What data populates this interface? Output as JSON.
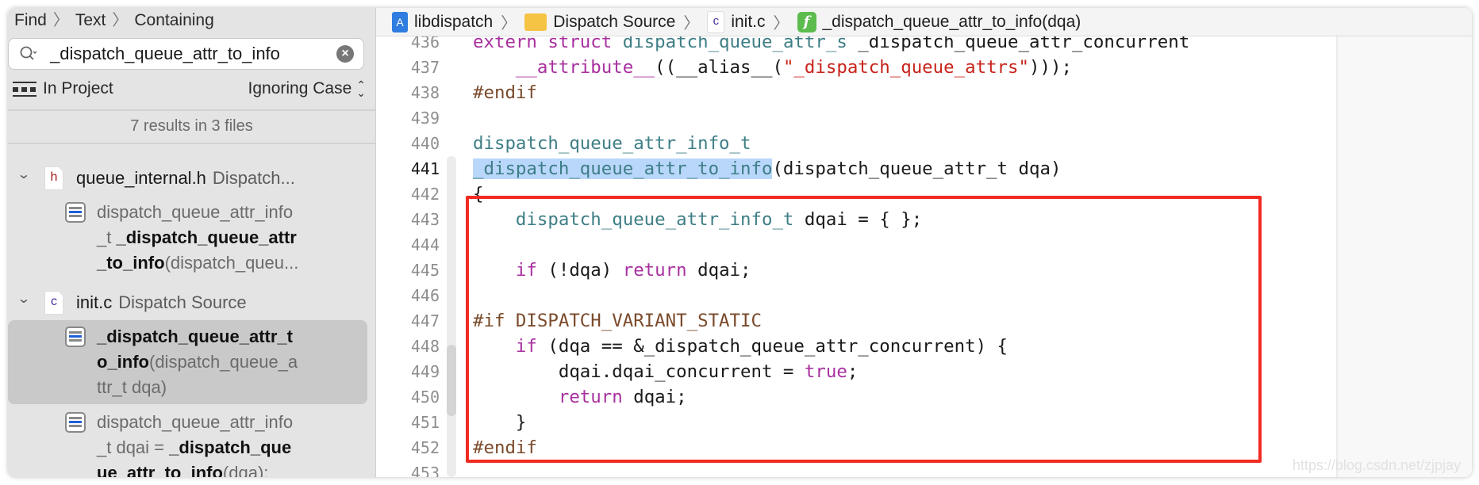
{
  "colors": {
    "type": "#3e7e86",
    "keyword": "#a8309f",
    "preproc": "#7a4a2a",
    "string": "#c8241c",
    "plain": "#1a1a1a",
    "highlight": "#b8d7fb",
    "annotation_box": "#f22a22"
  },
  "sidebar": {
    "find_path": [
      "Find",
      "Text",
      "Containing"
    ],
    "search": {
      "value": "_dispatch_queue_attr_to_info",
      "icon": "magnifier-with-dropdown",
      "clear_icon": "x-circle"
    },
    "scope": "In Project",
    "case_mode": "Ignoring Case",
    "results_summary": "7 results in 3 files",
    "files": [
      {
        "icon": "h",
        "name": "queue_internal.h",
        "group": "Dispatch...",
        "results": [
          {
            "selected": false,
            "lines": [
              [
                {
                  "t": "dispatch_queue_attr_info",
                  "b": false
                }
              ],
              [
                {
                  "t": "_t ",
                  "b": false
                },
                {
                  "t": "_dispatch_queue_attr",
                  "b": true
                }
              ],
              [
                {
                  "t": "_to_info",
                  "b": true
                },
                {
                  "t": "(dispatch_queu...",
                  "b": false
                }
              ]
            ]
          }
        ]
      },
      {
        "icon": "c",
        "name": "init.c",
        "group": "Dispatch Source",
        "results": [
          {
            "selected": true,
            "lines": [
              [
                {
                  "t": "_dispatch_queue_attr_t",
                  "b": true
                }
              ],
              [
                {
                  "t": "o_info",
                  "b": true
                },
                {
                  "t": "(dispatch_queue_a",
                  "b": false
                }
              ],
              [
                {
                  "t": "ttr_t dqa)",
                  "b": false
                }
              ]
            ]
          },
          {
            "selected": false,
            "lines": [
              [
                {
                  "t": "dispatch_queue_attr_info",
                  "b": false
                }
              ],
              [
                {
                  "t": "_t dqai = ",
                  "b": false
                },
                {
                  "t": "_dispatch_que",
                  "b": true
                }
              ],
              [
                {
                  "t": "ue_attr_to_info",
                  "b": true
                },
                {
                  "t": "(dqa);",
                  "b": false
                }
              ]
            ]
          }
        ]
      }
    ]
  },
  "jumpbar": [
    {
      "icon": "app-project",
      "label": "libdispatch"
    },
    {
      "icon": "folder",
      "label": "Dispatch Source"
    },
    {
      "icon": "c-file",
      "label": "init.c"
    },
    {
      "icon": "function",
      "label": "_dispatch_queue_attr_to_info(dqa)"
    }
  ],
  "editor": {
    "current_line": 441,
    "highlighted_text": "_dispatch_queue_attr_to_info",
    "lines": [
      {
        "n": 436,
        "tokens": [
          [
            "extern struct ",
            "keyword"
          ],
          [
            "dispatch_queue_attr_s",
            "type"
          ],
          [
            " _dispatch_queue_attr_concurrent",
            "plain"
          ]
        ]
      },
      {
        "n": 437,
        "tokens": [
          [
            "    ",
            "plain"
          ],
          [
            "__attribute__",
            "keyword"
          ],
          [
            "((__alias__(",
            "plain"
          ],
          [
            "\"_dispatch_queue_attrs\"",
            "string"
          ],
          [
            ")));",
            "plain"
          ]
        ]
      },
      {
        "n": 438,
        "tokens": [
          [
            "#endif",
            "preproc"
          ]
        ]
      },
      {
        "n": 439,
        "tokens": []
      },
      {
        "n": 440,
        "tokens": [
          [
            "dispatch_queue_attr_info_t",
            "type"
          ]
        ]
      },
      {
        "n": 441,
        "tokens": [
          [
            "_dispatch_queue_attr_to_info",
            "type-hl"
          ],
          [
            "(dispatch_queue_attr_t dqa)",
            "plain"
          ]
        ]
      },
      {
        "n": 442,
        "tokens": [
          [
            "{",
            "plain"
          ]
        ]
      },
      {
        "n": 443,
        "tokens": [
          [
            "    ",
            "plain"
          ],
          [
            "dispatch_queue_attr_info_t",
            "type"
          ],
          [
            " dqai = { };",
            "plain"
          ]
        ]
      },
      {
        "n": 444,
        "tokens": []
      },
      {
        "n": 445,
        "tokens": [
          [
            "    ",
            "plain"
          ],
          [
            "if",
            "keyword"
          ],
          [
            " (!dqa) ",
            "plain"
          ],
          [
            "return",
            "keyword"
          ],
          [
            " dqai;",
            "plain"
          ]
        ]
      },
      {
        "n": 446,
        "tokens": []
      },
      {
        "n": 447,
        "tokens": [
          [
            "#if ",
            "preproc"
          ],
          [
            "DISPATCH_VARIANT_STATIC",
            "preproc"
          ]
        ]
      },
      {
        "n": 448,
        "tokens": [
          [
            "    ",
            "plain"
          ],
          [
            "if",
            "keyword"
          ],
          [
            " (dqa == &_dispatch_queue_attr_concurrent) {",
            "plain"
          ]
        ]
      },
      {
        "n": 449,
        "tokens": [
          [
            "        dqai.dqai_concurrent = ",
            "plain"
          ],
          [
            "true",
            "keyword"
          ],
          [
            ";",
            "plain"
          ]
        ]
      },
      {
        "n": 450,
        "tokens": [
          [
            "        ",
            "plain"
          ],
          [
            "return",
            "keyword"
          ],
          [
            " dqai;",
            "plain"
          ]
        ]
      },
      {
        "n": 451,
        "tokens": [
          [
            "    }",
            "plain"
          ]
        ]
      },
      {
        "n": 452,
        "tokens": [
          [
            "#endif",
            "preproc"
          ]
        ]
      },
      {
        "n": 453,
        "tokens": []
      }
    ]
  },
  "watermark": "https://blog.csdn.net/zjpjay"
}
